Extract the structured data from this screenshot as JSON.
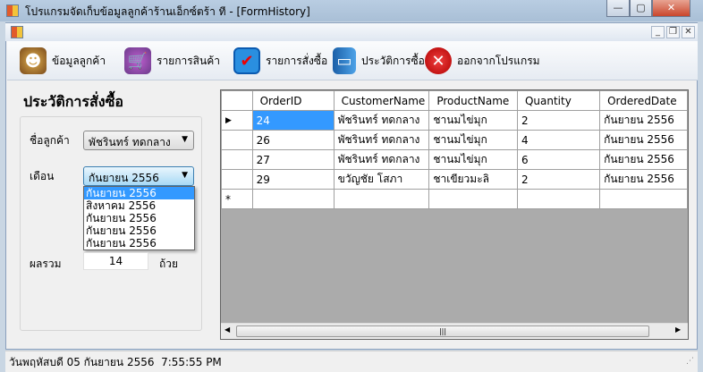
{
  "window": {
    "title": "โปรแกรมจัดเก็บข้อมูลลูกค้าร้านเอ็กซ์ตร้า ที - [FormHistory]"
  },
  "toolbar": [
    {
      "label": "ข้อมูลลูกค้า",
      "icon": "customers-icon"
    },
    {
      "label": "รายการสินค้า",
      "icon": "cart-icon"
    },
    {
      "label": "รายการสั่งซื้อ",
      "icon": "checklist-icon"
    },
    {
      "label": "ประวัติการซื้อ",
      "icon": "notebook-icon"
    },
    {
      "label": "ออกจากโปรแกรม",
      "icon": "exit-icon"
    }
  ],
  "form": {
    "heading": "ประวัติการสั่งซื้อ",
    "customer_label": "ชื่อลูกค้า",
    "customer_value": "พัชรินทร์ ทดกลาง",
    "month_label": "เดือน",
    "month_value": "กันยายน 2556",
    "month_options": [
      "กันยายน 2556",
      "สิงหาคม 2556",
      "กันยายน 2556",
      "กันยายน 2556",
      "กันยายน 2556"
    ],
    "total_label": "ผลรวม",
    "total_value": "14",
    "unit_label": "ถ้วย"
  },
  "grid": {
    "columns": [
      "OrderID",
      "CustomerName",
      "ProductName",
      "Quantity",
      "OrderedDate"
    ],
    "rows": [
      [
        "24",
        "พัชรินทร์ ทดกลาง",
        "ชานมไข่มุก",
        "2",
        "กันยายน 2556"
      ],
      [
        "26",
        "พัชรินทร์ ทดกลาง",
        "ชานมไข่มุก",
        "4",
        "กันยายน 2556"
      ],
      [
        "27",
        "พัชรินทร์ ทดกลาง",
        "ชานมไข่มุก",
        "6",
        "กันยายน 2556"
      ],
      [
        "29",
        "ขวัญชัย โสภา",
        "ชาเขียวมะลิ",
        "2",
        "กันยายน 2556"
      ]
    ],
    "new_row_marker": "*",
    "current_row_marker": "▶"
  },
  "status": {
    "text": "วันพฤหัสบดี 05 กันยายน 2556  7:55:55 PM"
  }
}
